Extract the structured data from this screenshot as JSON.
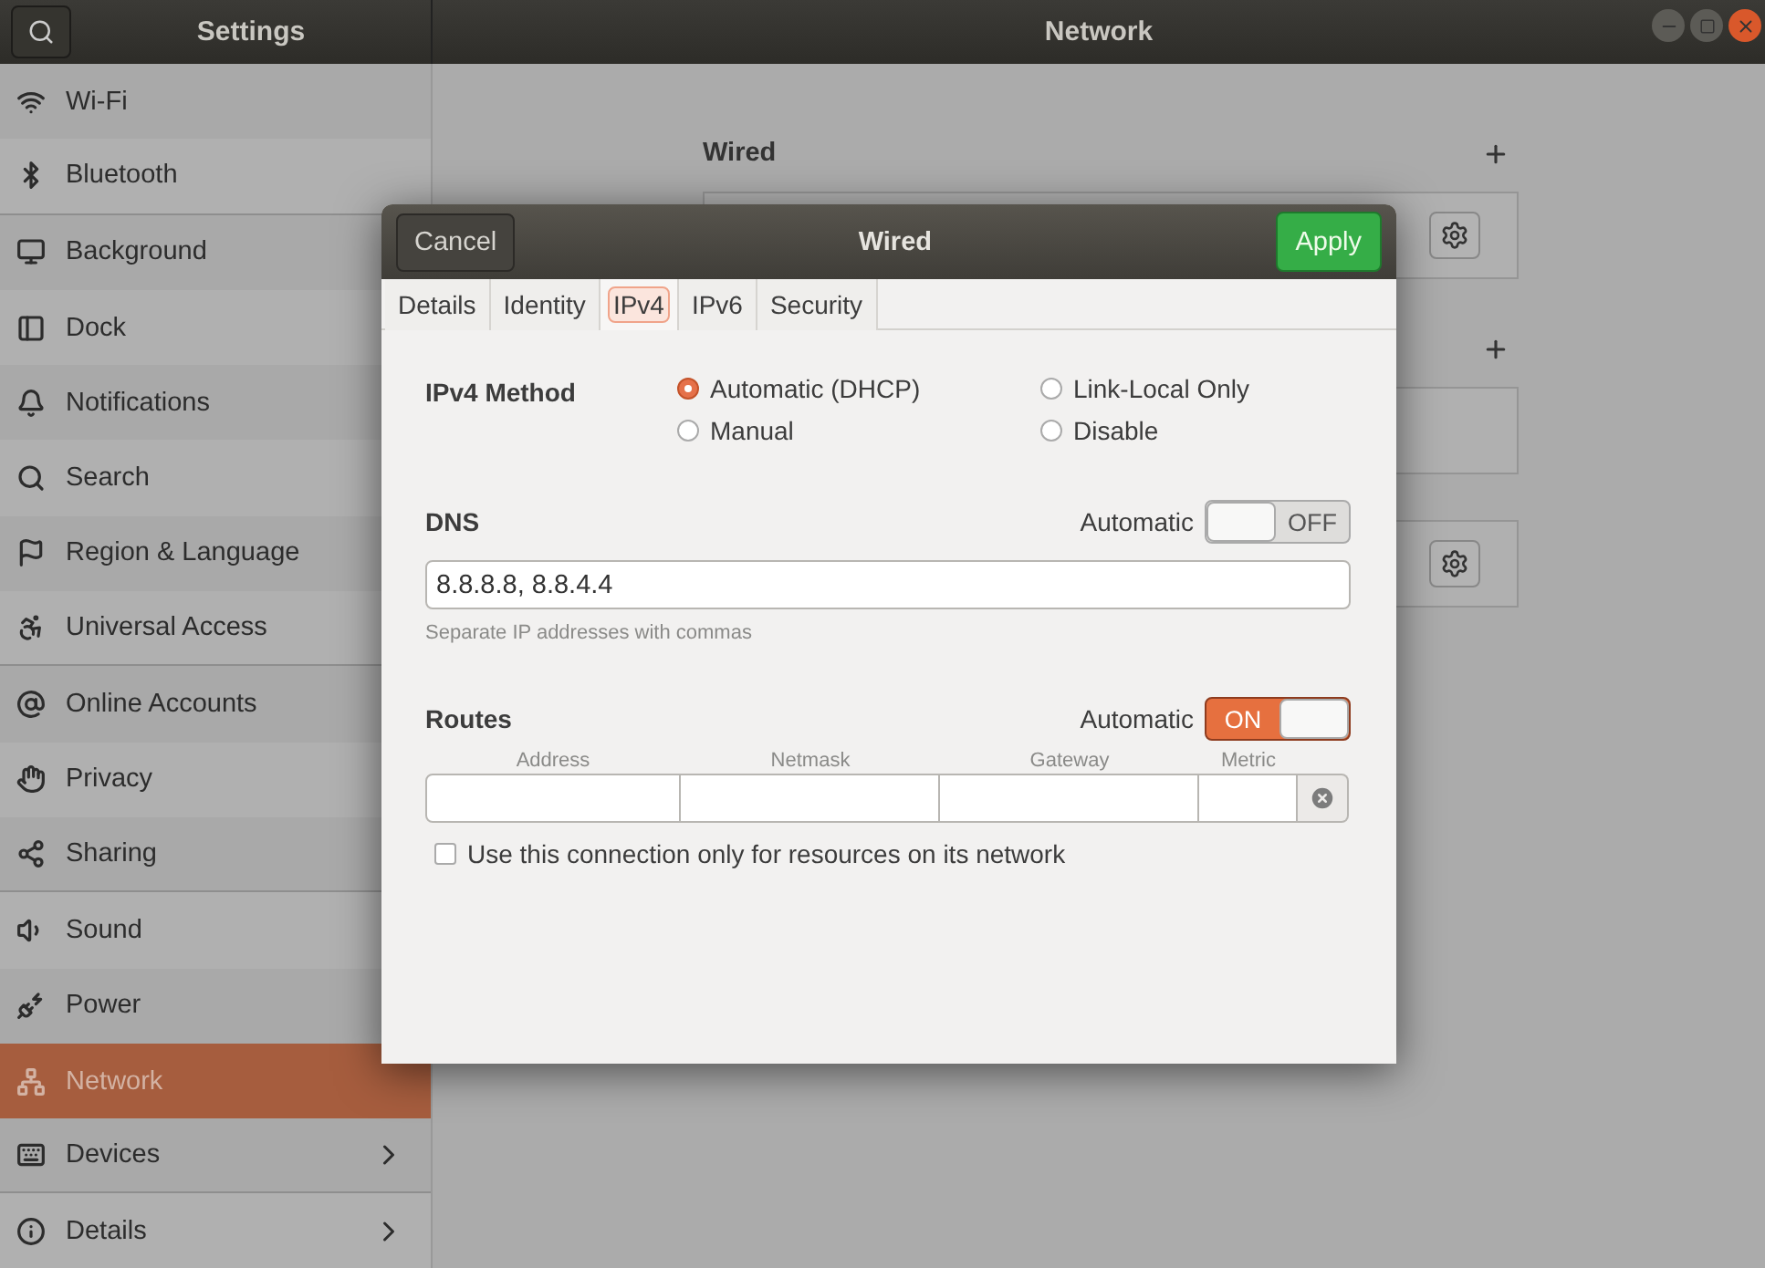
{
  "header": {
    "sidebar_title": "Settings",
    "title": "Network"
  },
  "sidebar": {
    "items": [
      {
        "label": "Wi-Fi",
        "selected": false,
        "chevron": false,
        "separator_after": false
      },
      {
        "label": "Bluetooth",
        "selected": false,
        "chevron": false,
        "separator_after": true
      },
      {
        "label": "Background",
        "selected": false,
        "separator_after": false
      },
      {
        "label": "Dock",
        "selected": false,
        "separator_after": false
      },
      {
        "label": "Notifications",
        "selected": false,
        "separator_after": false
      },
      {
        "label": "Search",
        "selected": false,
        "separator_after": false
      },
      {
        "label": "Region & Language",
        "selected": false,
        "separator_after": false
      },
      {
        "label": "Universal Access",
        "selected": false,
        "chevron": false,
        "separator_after": true
      },
      {
        "label": "Online Accounts",
        "selected": false,
        "separator_after": false
      },
      {
        "label": "Privacy",
        "selected": false,
        "separator_after": false
      },
      {
        "label": "Sharing",
        "selected": false,
        "chevron": false,
        "separator_after": true
      },
      {
        "label": "Sound",
        "selected": false,
        "separator_after": false
      },
      {
        "label": "Power",
        "selected": false,
        "separator_after": false
      },
      {
        "label": "Network",
        "selected": true,
        "chevron": false,
        "separator_after": false
      },
      {
        "label": "Devices",
        "selected": false,
        "chevron": true,
        "separator_after": true
      },
      {
        "label": "Details",
        "selected": false,
        "chevron": true,
        "separator_after": false
      }
    ]
  },
  "panel": {
    "sections": [
      {
        "heading": "Wired",
        "cards": [
          {
            "kind": "gear"
          }
        ]
      },
      {
        "cards": [
          {
            "kind": "empty"
          },
          {
            "kind": "gear"
          }
        ]
      }
    ]
  },
  "dialog": {
    "title": "Wired",
    "cancel": "Cancel",
    "apply": "Apply",
    "tabs": [
      {
        "label": "Details",
        "selected": false
      },
      {
        "label": "Identity",
        "selected": false
      },
      {
        "label": "IPv4",
        "selected": true
      },
      {
        "label": "IPv6",
        "selected": false
      },
      {
        "label": "Security",
        "selected": false
      }
    ],
    "ipv4_method": {
      "label": "IPv4 Method",
      "options": [
        {
          "label": "Automatic (DHCP)",
          "selected": true
        },
        {
          "label": "Link-Local Only",
          "selected": false
        },
        {
          "label": "Manual",
          "selected": false
        },
        {
          "label": "Disable",
          "selected": false
        }
      ]
    },
    "dns": {
      "label": "DNS",
      "automatic_label": "Automatic",
      "on": false,
      "switch_text": "OFF",
      "value": "8.8.8.8, 8.8.4.4",
      "hint": "Separate IP addresses with commas"
    },
    "routes": {
      "label": "Routes",
      "automatic_label": "Automatic",
      "on": true,
      "switch_text": "ON",
      "columns": [
        "Address",
        "Netmask",
        "Gateway",
        "Metric"
      ]
    },
    "only_local": {
      "label": "Use this connection only for resources on its network",
      "checked": false
    }
  }
}
